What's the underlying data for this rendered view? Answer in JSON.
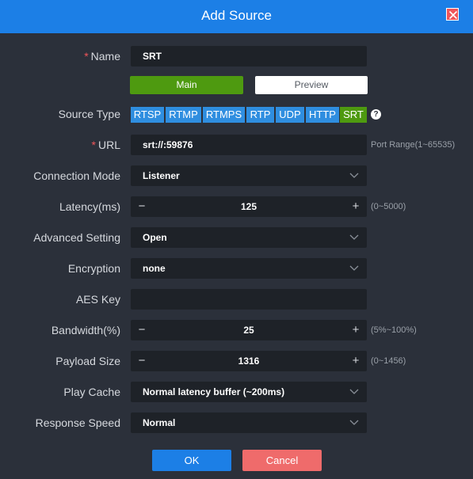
{
  "dialog": {
    "title": "Add Source",
    "close_icon": "close-icon",
    "accent_color": "#1c7fe6",
    "active_color": "#4e9a10"
  },
  "name": {
    "label": "Name",
    "required": "*",
    "value": "SRT"
  },
  "tabs": {
    "main": "Main",
    "preview": "Preview",
    "active": "Main"
  },
  "source_type": {
    "label": "Source Type",
    "options": [
      "RTSP",
      "RTMP",
      "RTMPS",
      "RTP",
      "UDP",
      "HTTP",
      "SRT"
    ],
    "selected": "SRT",
    "help": "?"
  },
  "url": {
    "label": "URL",
    "required": "*",
    "value": "srt://:59876",
    "hint": "Port Range(1~65535)"
  },
  "connection_mode": {
    "label": "Connection Mode",
    "value": "Listener"
  },
  "latency": {
    "label": "Latency(ms)",
    "value": "125",
    "hint": "(0~5000)",
    "minus": "−",
    "plus": "+"
  },
  "advanced_setting": {
    "label": "Advanced Setting",
    "value": "Open"
  },
  "encryption": {
    "label": "Encryption",
    "value": "none"
  },
  "aes_key": {
    "label": "AES Key",
    "value": ""
  },
  "bandwidth": {
    "label": "Bandwidth(%)",
    "value": "25",
    "hint": "(5%~100%)",
    "minus": "−",
    "plus": "+"
  },
  "payload_size": {
    "label": "Payload Size",
    "value": "1316",
    "hint": "(0~1456)",
    "minus": "−",
    "plus": "+"
  },
  "play_cache": {
    "label": "Play Cache",
    "value": "Normal latency buffer (~200ms)"
  },
  "response_speed": {
    "label": "Response Speed",
    "value": "Normal"
  },
  "footer": {
    "ok": "OK",
    "cancel": "Cancel"
  }
}
